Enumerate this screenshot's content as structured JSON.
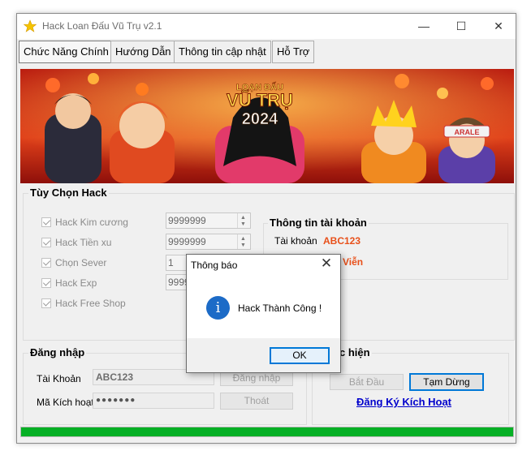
{
  "window": {
    "title": "Hack Loan Đấu Vũ Trụ v2.1",
    "icon": "star-icon",
    "controls": {
      "minimize": "—",
      "maximize": "☐",
      "close": "✕"
    }
  },
  "tabs": [
    {
      "label": "Chức Năng Chính",
      "active": true
    },
    {
      "label": "Hướng Dẫn",
      "active": false
    },
    {
      "label": "Thông tin cập nhật",
      "active": false
    },
    {
      "label": "Hỗ Trợ",
      "active": false
    }
  ],
  "banner": {
    "logo_line1": "LOẠN ĐẤU",
    "logo_line2": "VŨ TRỤ",
    "year": "2024"
  },
  "hack_options": {
    "title": "Tùy Chọn Hack",
    "items": [
      {
        "label": "Hack Kim cương",
        "checked": true,
        "value": "9999999"
      },
      {
        "label": "Hack Tiền xu",
        "checked": true,
        "value": "9999999"
      },
      {
        "label": "Chọn Sever",
        "checked": true,
        "value": "1"
      },
      {
        "label": "Hack Exp",
        "checked": true,
        "value": "9999"
      },
      {
        "label": "Hack Free Shop",
        "checked": true
      }
    ]
  },
  "account_info": {
    "title": "Thông tin tài khoản",
    "account_label": "Tài khoản",
    "account_value": "ABC123",
    "account_value_color": "#e8501a",
    "second_value": "Viễn"
  },
  "login": {
    "title": "Đăng nhập",
    "account_label": "Tài Khoản",
    "account_value": "ABC123",
    "code_label": "Mã Kích hoạt",
    "code_value": "●●●●●●●",
    "login_button": "Đăng nhập",
    "logout_button": "Thoát"
  },
  "action": {
    "title_visible": "c hiện",
    "start_button": "Bắt Đầu",
    "pause_button": "Tạm Dừng",
    "register_link": "Đăng Ký Kích Hoạt",
    "link_color": "#0000cc"
  },
  "progress": {
    "fraction": 1.0,
    "color": "#06b025"
  },
  "dialog": {
    "title": "Thông báo",
    "message": "Hack Thành Công !",
    "ok_button": "OK",
    "icon": "info-icon"
  }
}
